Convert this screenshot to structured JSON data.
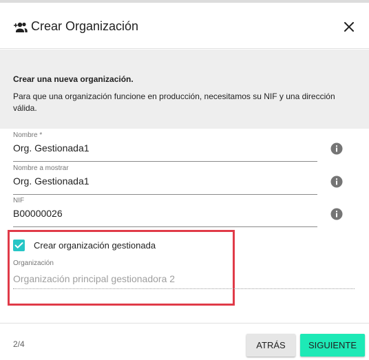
{
  "dialog": {
    "title": "Crear Organización",
    "title_icon": "add-group-icon",
    "close_icon": "close-icon"
  },
  "info": {
    "title": "Crear una nueva organización.",
    "text": "Para que una organización funcione en producción, necesitamos su NIF y una dirección válida."
  },
  "form": {
    "nombre": {
      "label": "Nombre *",
      "value": "Org. Gestionada1"
    },
    "nombre_mostrar": {
      "label": "Nombre a mostrar",
      "value": "Org. Gestionada1"
    },
    "nif": {
      "label": "NIF",
      "value": "B00000026"
    },
    "info_icon": "info-icon",
    "managed_checkbox": {
      "label": "Crear organización gestionada",
      "checked": true
    },
    "organizacion": {
      "label": "Organización",
      "placeholder": "Organización principal gestionadora 2"
    }
  },
  "footer": {
    "step": "2/4",
    "back_label": "ATRÁS",
    "next_label": "SIGUIENTE"
  },
  "colors": {
    "accent": "#1de9b6",
    "checkbox": "#26c6c6",
    "highlight": "#e03a48"
  }
}
